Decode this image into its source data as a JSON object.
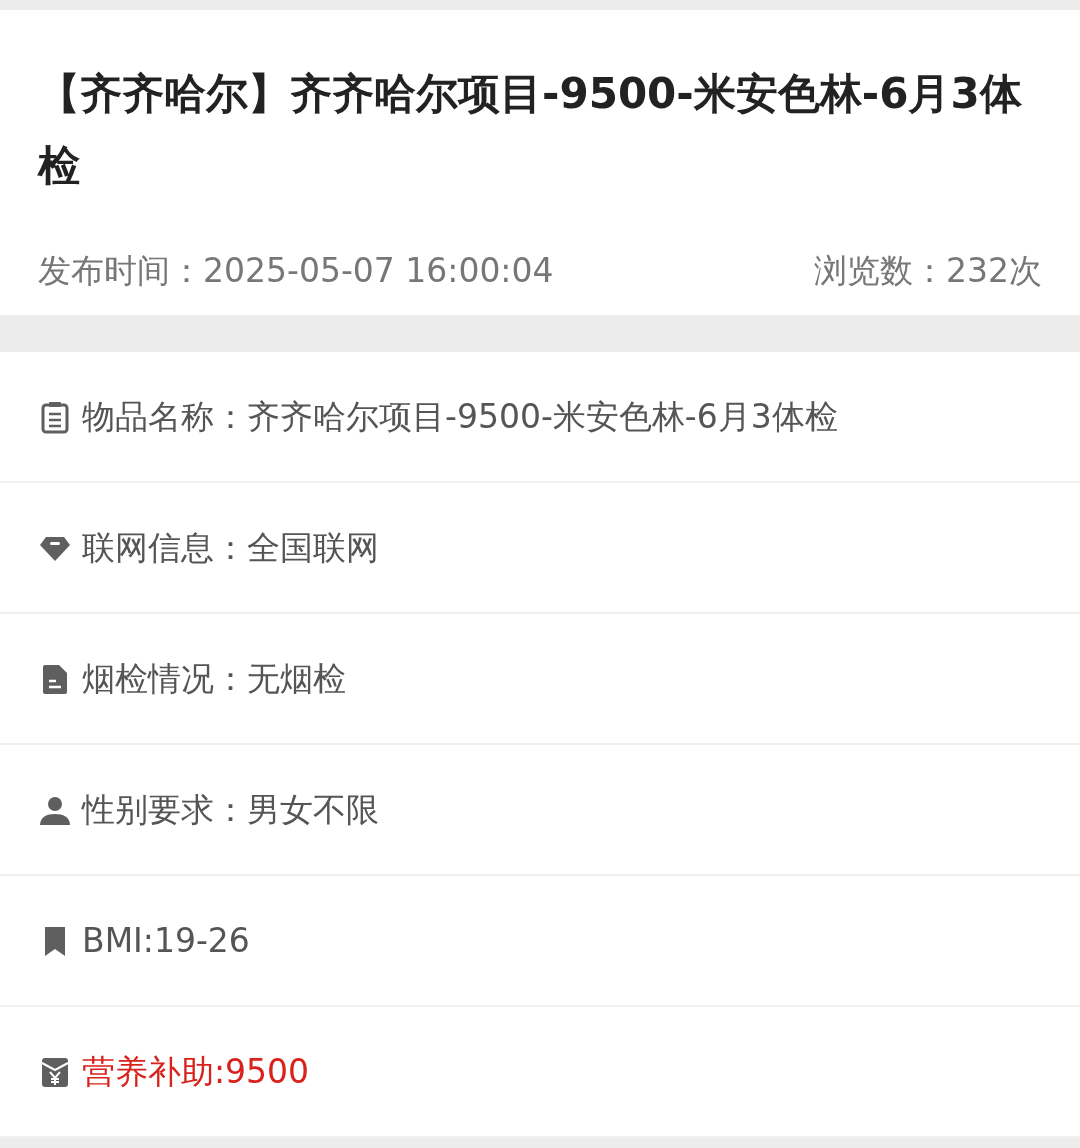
{
  "title": "【齐齐哈尔】齐齐哈尔项目-9500-米安色林-6月3体检",
  "publish_time": "发布时间：2025-05-07 16:00:04",
  "views": "浏览数：232次",
  "details": [
    {
      "kind": "list",
      "text": "物品名称：齐齐哈尔项目-9500-米安色林-6月3体检",
      "highlighted": false
    },
    {
      "kind": "gem",
      "text": "联网信息：全国联网",
      "highlighted": false
    },
    {
      "kind": "file",
      "text": "烟检情况：无烟检",
      "highlighted": false
    },
    {
      "kind": "person",
      "text": "性别要求：男女不限",
      "highlighted": false
    },
    {
      "kind": "bookmark",
      "text": "BMI:19-26",
      "highlighted": false
    },
    {
      "kind": "envelope",
      "text": "营养补助:9500",
      "highlighted": true
    }
  ]
}
